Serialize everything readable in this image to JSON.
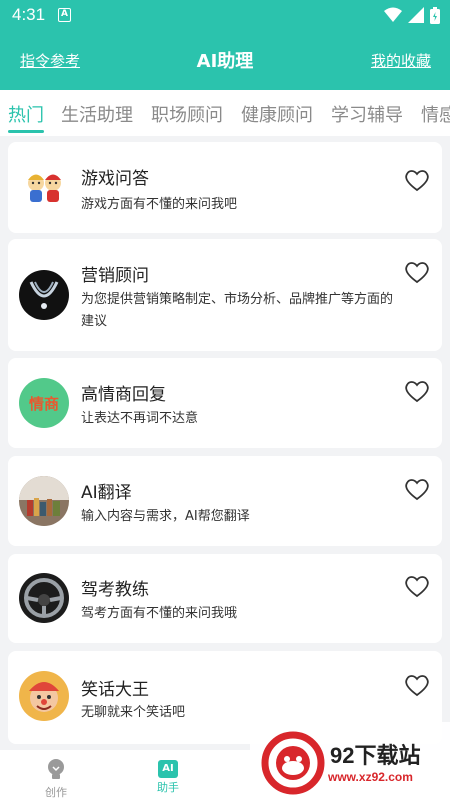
{
  "status_bar": {
    "time": "4:31",
    "notification_glyph": "A",
    "icons": [
      "wifi-icon",
      "signal-icon",
      "battery-icon"
    ]
  },
  "header": {
    "left_link": "指令参考",
    "title": "AI助理",
    "right_link": "我的收藏"
  },
  "tabs": [
    {
      "label": "热门",
      "active": true
    },
    {
      "label": "生活助理",
      "active": false
    },
    {
      "label": "职场顾问",
      "active": false
    },
    {
      "label": "健康顾问",
      "active": false
    },
    {
      "label": "学习辅导",
      "active": false
    },
    {
      "label": "情感",
      "active": false
    }
  ],
  "assistants": [
    {
      "name": "游戏问答",
      "desc": "游戏方面有不懂的来问我吧",
      "avatar": "cartoon-avatar"
    },
    {
      "name": "营销顾问",
      "desc": "为您提供营销策略制定、市场分析、品牌推广等方面的建议",
      "avatar": "necklace-avatar"
    },
    {
      "name": "高情商回复",
      "desc": "让表达不再词不达意",
      "avatar": "eq-avatar",
      "avatar_text": "情商"
    },
    {
      "name": "AI翻译",
      "desc": "输入内容与需求，AI帮您翻译",
      "avatar": "books-avatar"
    },
    {
      "name": "驾考教练",
      "desc": "驾考方面有不懂的来问我哦",
      "avatar": "steering-wheel-avatar"
    },
    {
      "name": "笑话大王",
      "desc": "无聊就来个笑话吧",
      "avatar": "clown-avatar"
    }
  ],
  "bottom_nav": [
    {
      "label": "创作",
      "icon": "bulb-icon",
      "active": false
    },
    {
      "label": "助手",
      "icon": "ai-icon",
      "icon_text": "AI",
      "active": true
    }
  ],
  "watermark": {
    "brand": "92下载站",
    "url": "www.xz92.com"
  },
  "colors": {
    "accent": "#2bc3ad",
    "background": "#f2f3f5",
    "eq_avatar": "#52c98a",
    "eq_text": "#e9582f",
    "watermark_red": "#d8262b"
  }
}
